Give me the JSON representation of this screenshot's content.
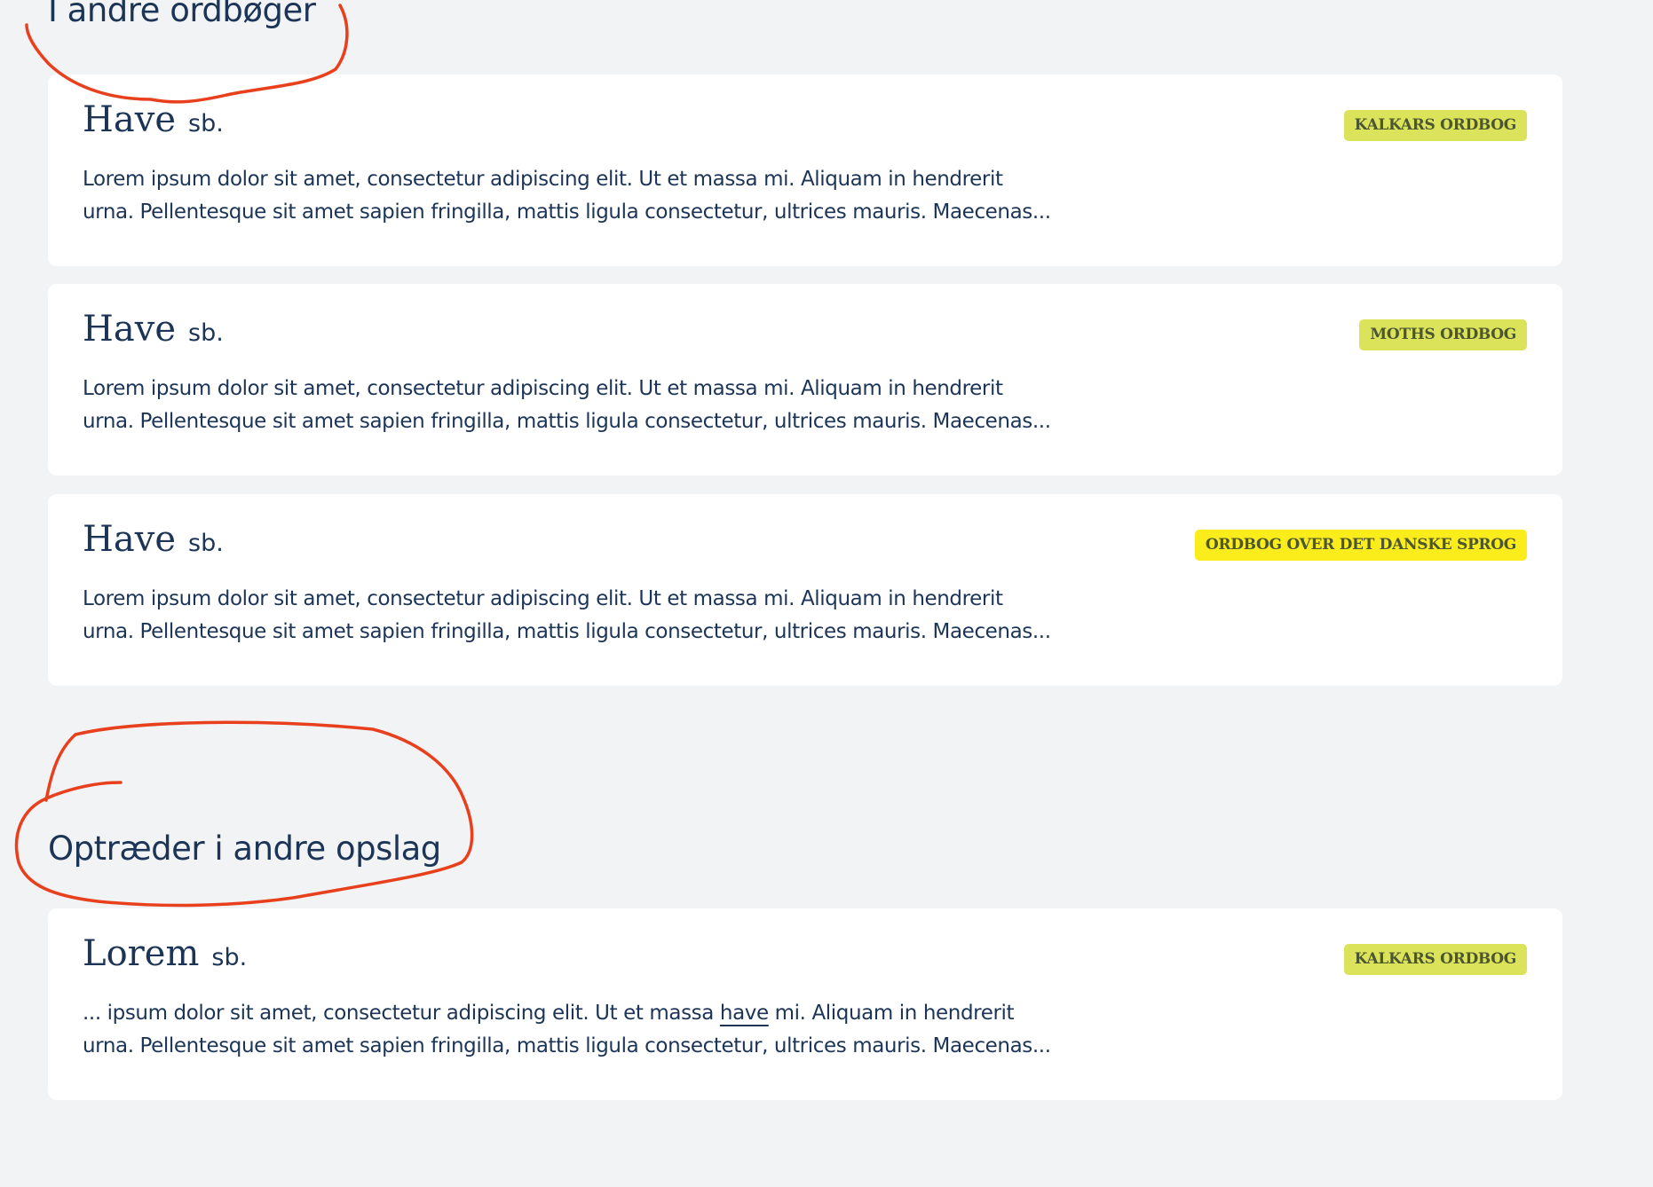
{
  "sections": [
    {
      "heading": "I andre ordbøger",
      "entries": [
        {
          "headword": "Have",
          "pos": "sb.",
          "source": "KALKARS ORDBOG",
          "line1": "Lorem ipsum dolor sit amet, consectetur adipiscing elit. Ut et massa mi. Aliquam in hendrerit",
          "line2": "urna. Pellentesque sit amet sapien fringilla, mattis ligula consectetur, ultrices mauris. Maecenas..."
        },
        {
          "headword": "Have",
          "pos": "sb.",
          "source": "MOTHS ORDBOG",
          "line1": "Lorem ipsum dolor sit amet, consectetur adipiscing elit. Ut et massa mi. Aliquam in hendrerit",
          "line2": "urna. Pellentesque sit amet sapien fringilla, mattis ligula consectetur, ultrices mauris. Maecenas..."
        },
        {
          "headword": "Have",
          "pos": "sb.",
          "source": "ORDBOG OVER DET DANSKE SPROG",
          "line1": "Lorem ipsum dolor sit amet, consectetur adipiscing elit. Ut et massa mi. Aliquam in hendrerit",
          "line2": "urna. Pellentesque sit amet sapien fringilla, mattis ligula consectetur, ultrices mauris. Maecenas..."
        }
      ]
    },
    {
      "heading": "Optræder i andre opslag",
      "entries": [
        {
          "headword": "Lorem",
          "pos": "sb.",
          "source": "KALKARS ORDBOG",
          "line1_before": "... ipsum dolor sit amet, consectetur adipiscing elit. Ut et massa",
          "line1_highlight": "have",
          "line1_after": "mi. Aliquam in hendrerit",
          "line2": "urna. Pellentesque sit amet sapien fringilla, mattis ligula consectetur, ultrices mauris. Maecenas..."
        }
      ]
    }
  ],
  "colors": {
    "background": "#f2f3f5",
    "card": "#ffffff",
    "text": "#1c3557",
    "badge": "#dbe35a",
    "badge_bright": "#fbec1c",
    "annotation": "#e8401c"
  }
}
